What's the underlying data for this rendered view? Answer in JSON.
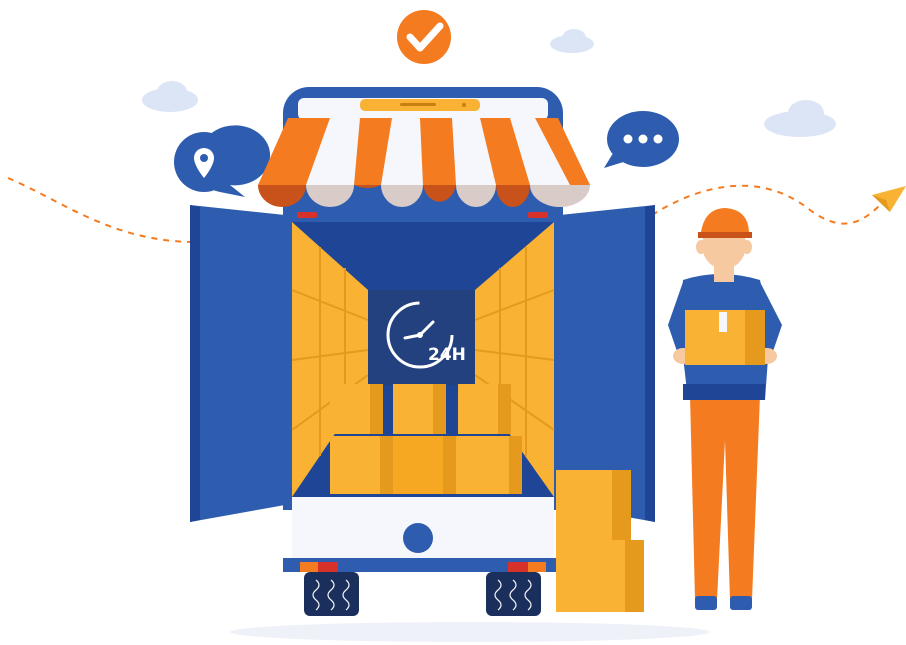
{
  "illustration": {
    "clock_label": "24H",
    "colors": {
      "truck_blue": "#2E5DB0",
      "truck_blue_dark": "#1F4596",
      "awning_orange": "#F47B20",
      "box_yellow": "#F9B233",
      "box_shadow": "#E59A1E",
      "cloud": "#DCE5F5",
      "check_orange": "#F47B20",
      "path_orange": "#F47B20"
    },
    "icons": [
      "check-icon",
      "location-pin-icon",
      "chat-bubble-icon",
      "paper-plane-icon",
      "clock-icon",
      "cloud-icon"
    ]
  }
}
